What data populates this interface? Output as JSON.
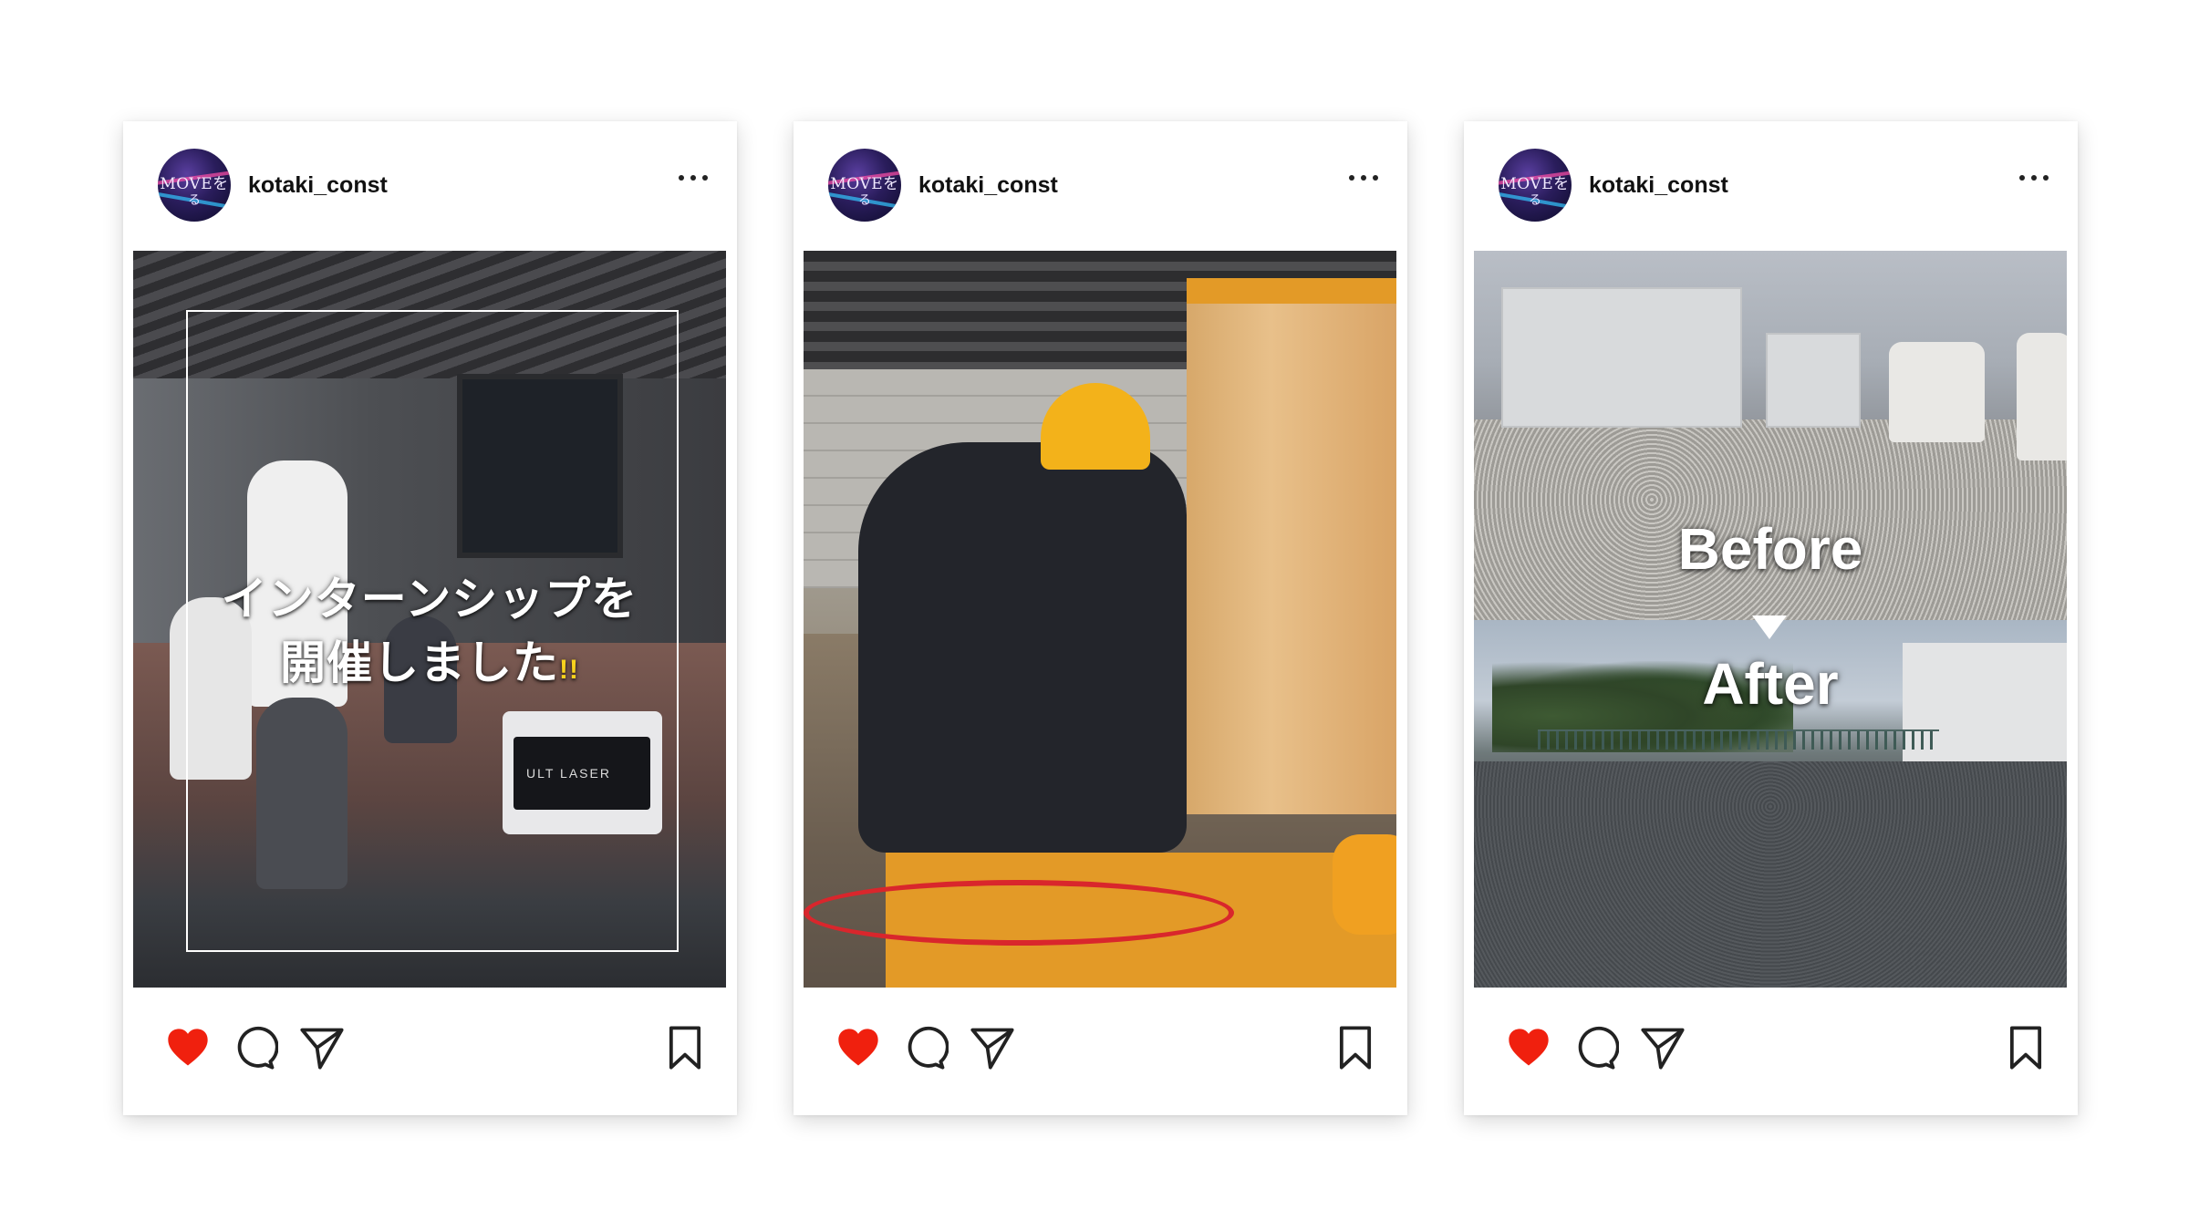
{
  "posts": [
    {
      "username": "kotaki_const",
      "avatar_text_1": "MOVEを",
      "avatar_text_2": "る",
      "overlay_line_1": "インターンシップを",
      "overlay_line_2": "開催しました",
      "overlay_mark": "!!",
      "equipment_label": "ULT LASER",
      "liked": true
    },
    {
      "username": "kotaki_const",
      "avatar_text_1": "MOVEを",
      "avatar_text_2": "る",
      "liked": true
    },
    {
      "username": "kotaki_const",
      "avatar_text_1": "MOVEを",
      "avatar_text_2": "る",
      "before_label": "Before",
      "after_label": "After",
      "liked": true
    }
  ],
  "colors": {
    "like_red": "#f0200e",
    "icon_stroke": "#222222",
    "card_bg": "#ffffff"
  },
  "icons": [
    "heart-icon",
    "comment-icon",
    "share-icon",
    "bookmark-icon",
    "more-options-icon"
  ]
}
